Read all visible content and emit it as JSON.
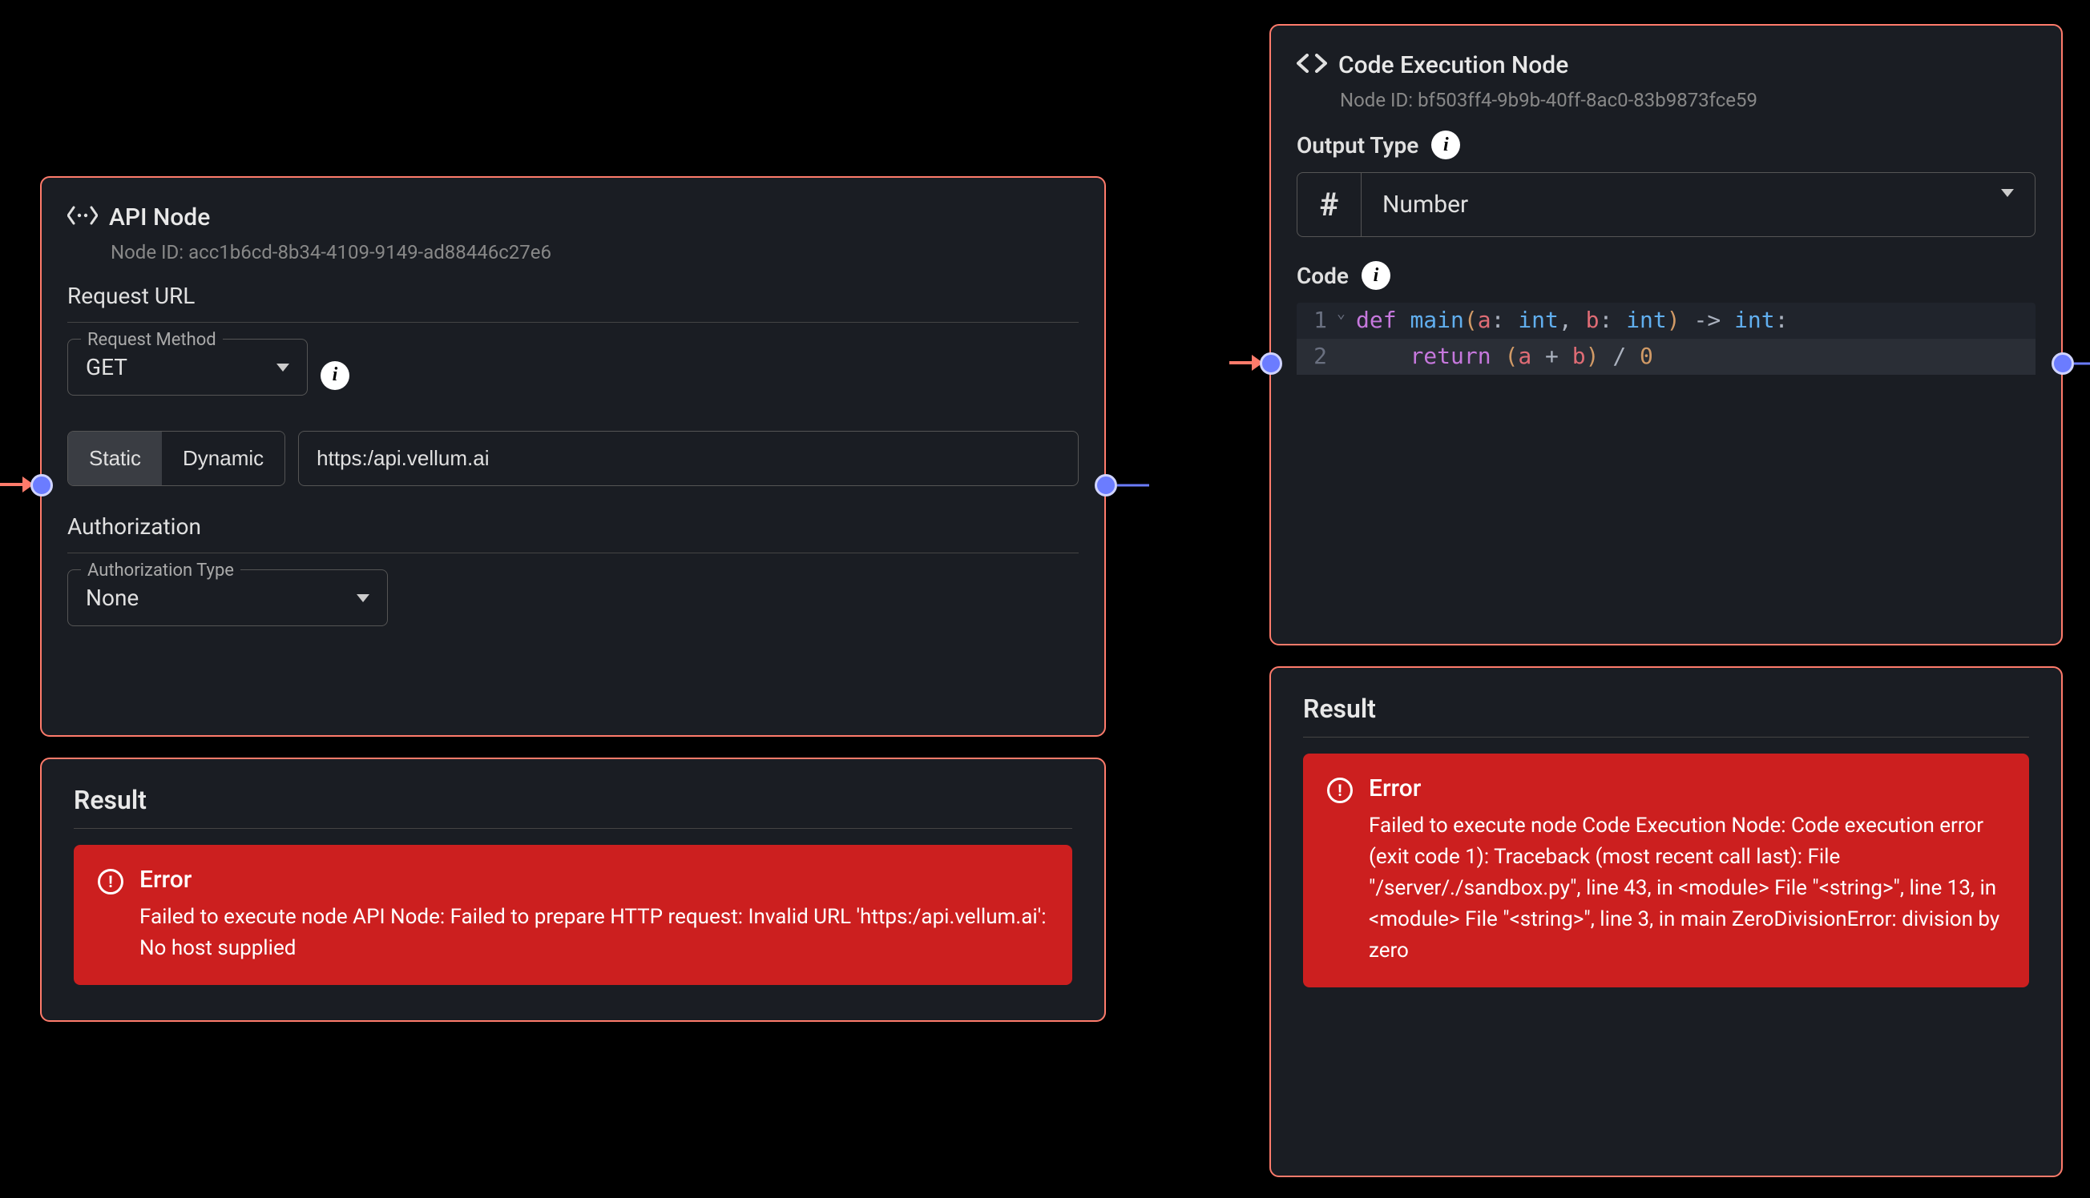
{
  "api_node": {
    "title": "API Node",
    "node_id_label": "Node ID:",
    "node_id": "acc1b6cd-8b34-4109-9149-ad88446c27e6",
    "request_url_label": "Request URL",
    "request_method_legend": "Request Method",
    "request_method_value": "GET",
    "tab_static": "Static",
    "tab_dynamic": "Dynamic",
    "url_value": "https:/api.vellum.ai",
    "auth_label": "Authorization",
    "auth_type_legend": "Authorization Type",
    "auth_type_value": "None"
  },
  "api_result": {
    "heading": "Result",
    "error_title": "Error",
    "error_message": "Failed to execute node API Node: Failed to prepare HTTP request: Invalid URL 'https:/api.vellum.ai': No host supplied"
  },
  "code_node": {
    "title": "Code Execution Node",
    "node_id_label": "Node ID:",
    "node_id": "bf503ff4-9b9b-40ff-8ac0-83b9873fce59",
    "output_type_label": "Output Type",
    "output_type_value": "Number",
    "output_type_icon": "#",
    "code_label": "Code",
    "lines": {
      "l1": "1",
      "l2": "2"
    },
    "tokens": {
      "def": "def",
      "main": "main",
      "a": "a",
      "b": "b",
      "int": "int",
      "arrow": "->",
      "colon": ":",
      "return": "return",
      "plus": "+",
      "div": "/",
      "zero": "0",
      "lp": "(",
      "rp": ")",
      "comma": ","
    }
  },
  "code_result": {
    "heading": "Result",
    "error_title": "Error",
    "error_message": "Failed to execute node Code Execution Node: Code execution error (exit code 1): Traceback (most recent call last): File \"/server/./sandbox.py\", line 43, in <module> File \"<string>\", line 13, in <module> File \"<string>\", line 3, in main ZeroDivisionError: division by zero"
  }
}
